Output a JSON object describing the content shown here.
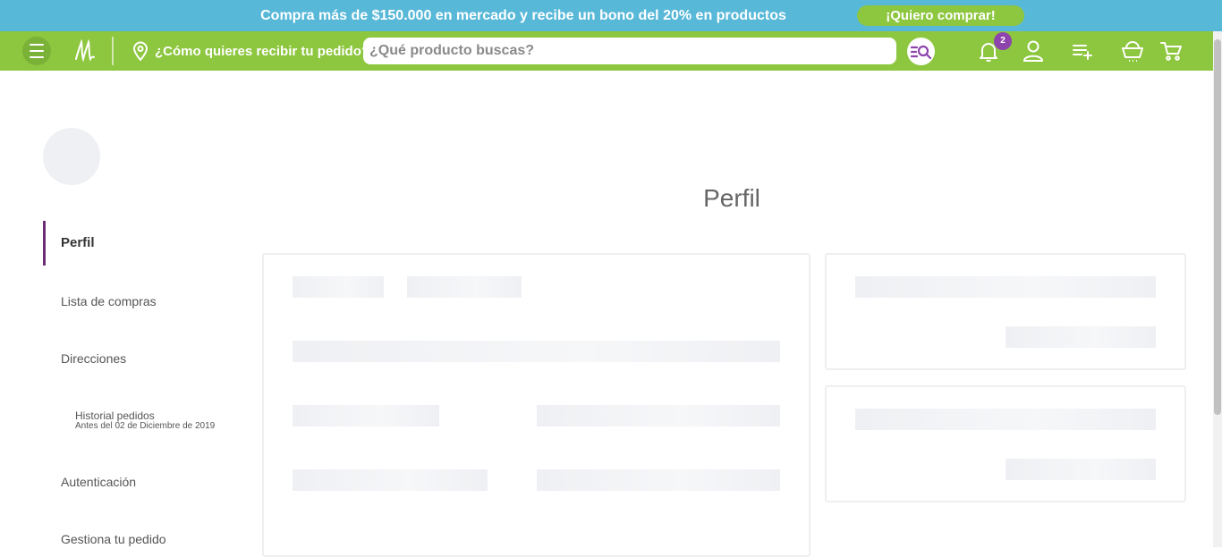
{
  "promo_banner": {
    "message": "Compra más de $150.000 en mercado y recibe un bono del 20% en productos",
    "cta_label": "¡Quiero comprar!"
  },
  "navbar": {
    "delivery_label": "¿Cómo quieres recibir tu pedido?",
    "search_placeholder": "¿Qué producto buscas?",
    "search_value": "",
    "notifications_count": "2",
    "icons": [
      "menu-icon",
      "logo-icon",
      "location-pin-icon",
      "search-icon",
      "bell-icon",
      "user-icon",
      "list-add-icon",
      "basket-icon",
      "cart-icon"
    ]
  },
  "sidebar": {
    "items": [
      {
        "label": "Perfil",
        "active": true
      },
      {
        "label": "Lista de compras"
      },
      {
        "label": "Direcciones"
      },
      {
        "label": "Historial pedidos",
        "sublabel": "Antes del 02 de Diciembre de 2019"
      },
      {
        "label": "Autenticación"
      },
      {
        "label": "Gestiona tu pedido"
      }
    ]
  },
  "main": {
    "title": "Perfil"
  },
  "colors": {
    "banner": "#58b8d8",
    "navbar": "#8dc63f",
    "accent": "#6b2c75",
    "badge": "#8e44ad",
    "search_icon": "#8e44ad"
  }
}
